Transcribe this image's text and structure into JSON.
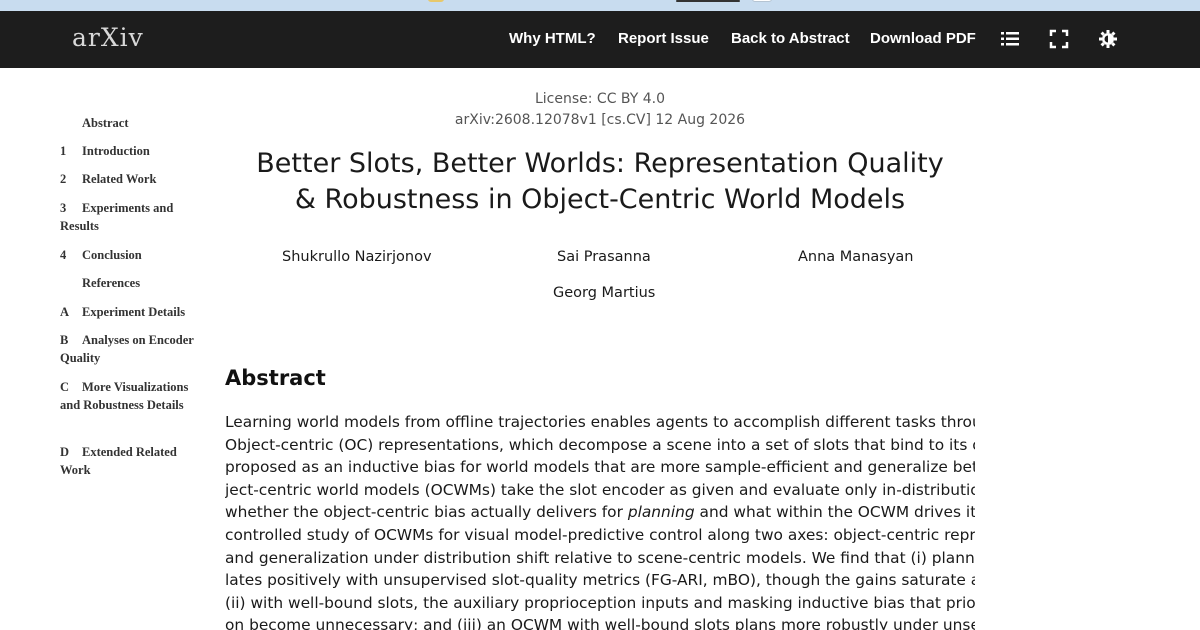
{
  "navbar": {
    "logo": "arXiv",
    "links": [
      "Why HTML?",
      "Report Issue",
      "Back to Abstract",
      "Download PDF"
    ],
    "icons": [
      "list-icon",
      "fullscreen-icon",
      "theme-gear-icon"
    ]
  },
  "toc": {
    "items": [
      {
        "num": "",
        "label": "Abstract"
      },
      {
        "num": "1",
        "label": "Introduction"
      },
      {
        "num": "2",
        "label": "Related Work"
      },
      {
        "num": "3",
        "label": "Experiments and Results"
      },
      {
        "num": "4",
        "label": "Conclusion"
      },
      {
        "num": "",
        "label": "References"
      },
      {
        "num": "A",
        "label": "Experiment Details"
      },
      {
        "num": "B",
        "label": "Analyses on Encoder Quality"
      },
      {
        "num": "C",
        "label": "More Visualizations and Robustness Details"
      },
      {
        "num": "D",
        "label": "Extended Related Work"
      }
    ]
  },
  "paper": {
    "license": "License: CC BY 4.0",
    "arxiv_id": "arXiv:2608.12078v1 [cs.CV] 12 Aug 2026",
    "title_line1": "Better Slots, Better Worlds: Representation Quality",
    "title_line2": "& Robustness in Object-Centric World Models",
    "authors": [
      "Shukrullo Nazirjonov",
      "Sai Prasanna",
      "Anna Manasyan",
      "Georg Martius"
    ],
    "abstract_heading": "Abstract",
    "abstract_lines": [
      "Learning world models from offline trajectories enables agents to accomplish different tasks through planning.",
      "Object-centric (OC) representations, which decompose a scene into a set of slots that bind to its objects, have been",
      "proposed as an inductive bias for world models that are more sample-efficient and generalize better. Yet prior ob-",
      "ject-centric world models (OCWMs) take the slot encoder as given and evaluate only in-distribution, leaving open",
      "whether the object-centric bias actually delivers for",
      "planning",
      "and what within the OCWM drives it. We conduct a",
      "controlled study of OCWMs for visual model-predictive control along two axes: object-centric representation quality",
      "and generalization under distribution shift relative to scene-centric models. We find that (i) planning success corre-",
      "lates positively with unsupervised slot-quality metrics (FG-ARI, mBO), though the gains saturate at high slot quality;",
      "(ii) with well-bound slots, the auxiliary proprioception inputs and masking inductive bias that prior methods relied",
      "on become unnecessary; and (iii) an OCWM with well-bound slots plans more robustly under unseen distribution"
    ]
  }
}
